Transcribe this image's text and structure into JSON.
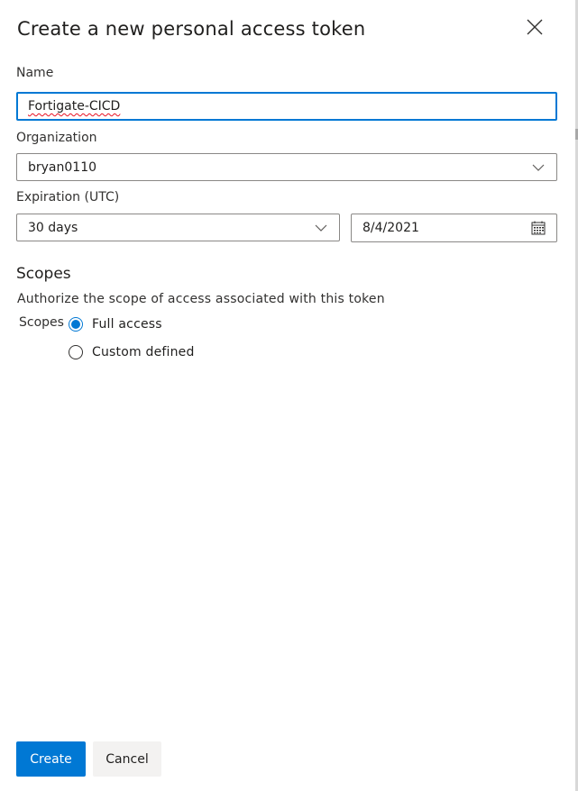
{
  "dialog": {
    "title": "Create a new personal access token"
  },
  "form": {
    "name_label": "Name",
    "name_value": "Fortigate-CICD",
    "organization_label": "Organization",
    "organization_value": "bryan0110",
    "expiration_label": "Expiration (UTC)",
    "expiration_value": "30 days",
    "expiration_date": "8/4/2021"
  },
  "scopes": {
    "title": "Scopes",
    "description": "Authorize the scope of access associated with this token",
    "group_label": "Scopes",
    "options": [
      {
        "label": "Full access",
        "selected": true
      },
      {
        "label": "Custom defined",
        "selected": false
      }
    ]
  },
  "footer": {
    "create_label": "Create",
    "cancel_label": "Cancel"
  },
  "colors": {
    "accent": "#0078d4",
    "field_border": "#8a8886",
    "secondary_button": "#f3f2f1"
  },
  "icons": {
    "close": "close-icon",
    "dropdown": "chevron-down-icon",
    "calendar": "calendar-icon"
  }
}
